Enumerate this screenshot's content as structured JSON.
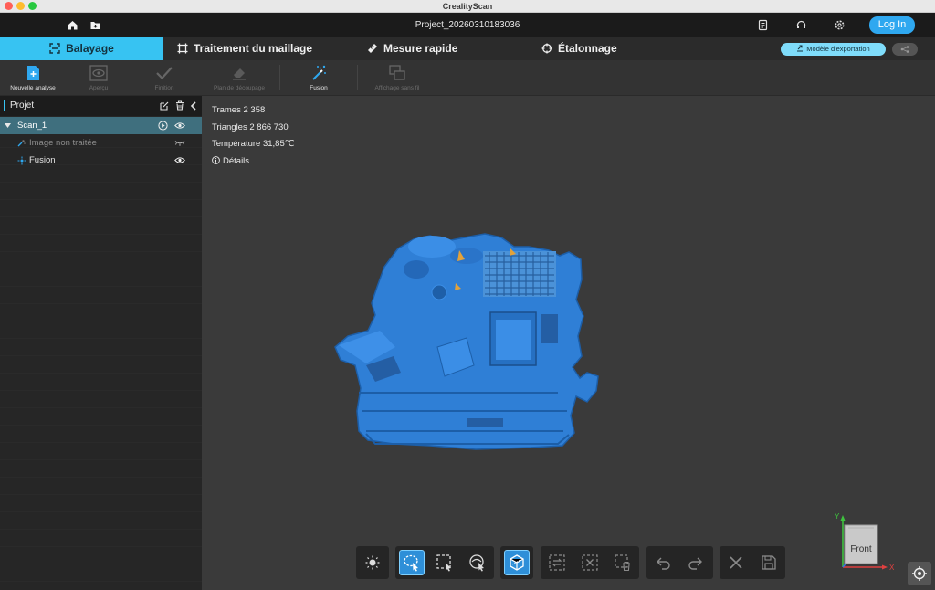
{
  "window": {
    "title": "CrealityScan"
  },
  "header": {
    "project_name": "Project_20260310183036",
    "login_label": "Log In"
  },
  "tabs": [
    {
      "label": "Balayage",
      "active": true
    },
    {
      "label": "Traitement du maillage",
      "active": false
    },
    {
      "label": "Mesure rapide",
      "active": false
    },
    {
      "label": "Étalonnage",
      "active": false
    }
  ],
  "export_label": "Modèle d'exportation",
  "toolbar": {
    "new_scan": "Nouvelle analyse",
    "preview": "Aperçu",
    "finish": "Finition",
    "cut_plane": "Plan de découpage",
    "fusion": "Fusion",
    "wireless_display": "Affichage sans fil"
  },
  "sidebar": {
    "title": "Projet",
    "items": [
      {
        "label": "Scan_1",
        "selected": true
      },
      {
        "label": "Image non traitée",
        "selected": false
      },
      {
        "label": "Fusion",
        "selected": false
      }
    ]
  },
  "stats": {
    "frames": "Trames 2 358",
    "triangles": "Triangles 2 866 730",
    "temperature": "Température 31,85℃",
    "details": "Détails"
  },
  "view": {
    "orientation_label": "Front",
    "axis_x": "X",
    "axis_y": "Y"
  },
  "colors": {
    "accent": "#37c3f2",
    "model": "#2f7fd6",
    "login": "#2fa8f0"
  }
}
